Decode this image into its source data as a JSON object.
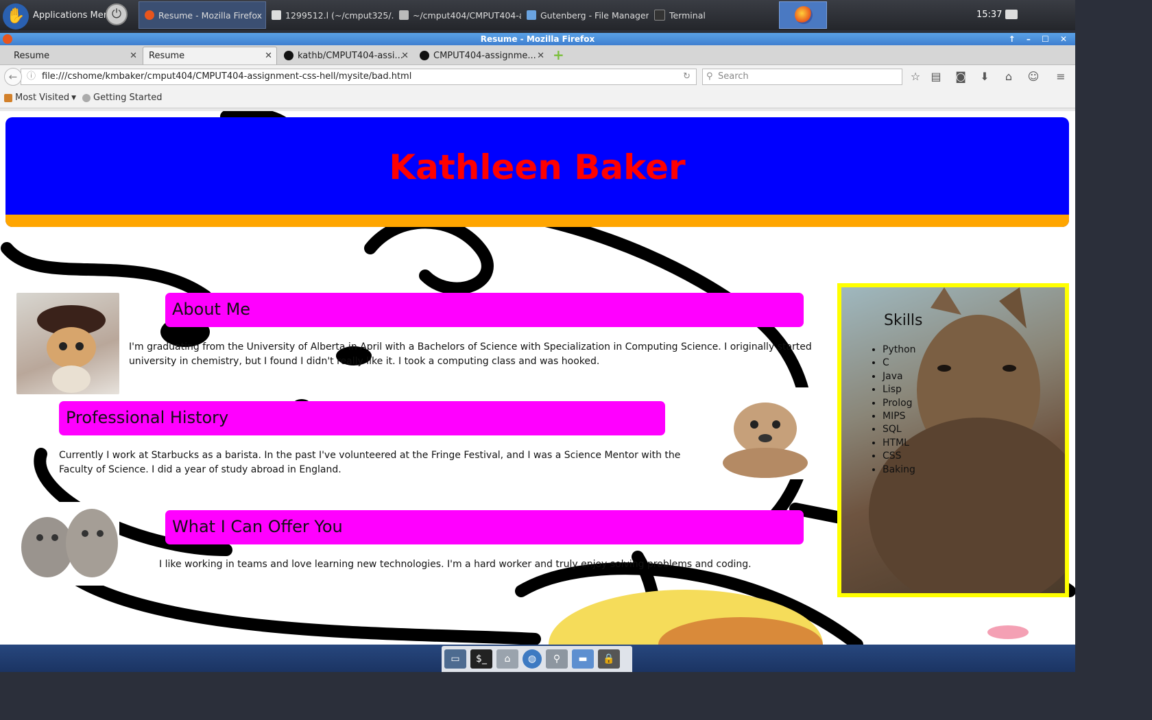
{
  "panel": {
    "apps_menu": "Applications Menu",
    "tasks": [
      {
        "label": "Resume - Mozilla Firefox"
      },
      {
        "label": "1299512.l (~/cmput325/..."
      },
      {
        "label": "~/cmput404/CMPUT404-a..."
      },
      {
        "label": "Gutenberg - File Manager"
      },
      {
        "label": "Terminal"
      }
    ],
    "clock": "15:37"
  },
  "window": {
    "title": "Resume - Mozilla Firefox",
    "tabs": [
      {
        "label": "Resume"
      },
      {
        "label": "Resume"
      },
      {
        "label": "kathb/CMPUT404-assi..."
      },
      {
        "label": "CMPUT404-assignme..."
      }
    ],
    "url": "file:///cshome/kmbaker/cmput404/CMPUT404-assignment-css-hell/mysite/bad.html",
    "search_placeholder": "Search",
    "bookmarks": [
      {
        "label": "Most Visited"
      },
      {
        "label": "Getting Started"
      }
    ]
  },
  "page": {
    "name": "Kathleen Baker",
    "sections": [
      {
        "heading": "About Me",
        "text": "I'm graduating from the University of Alberta in April with a Bachelors of Science with Specialization in Computing Science. I originally started university in chemistry, but I found I didn't really like it. I took a computing class and was hooked."
      },
      {
        "heading": "Professional History",
        "text": "Currently I work at Starbucks as a barista. In the past I've volunteered at the Fringe Festival, and I was a Science Mentor with the Faculty of Science. I did a year of study abroad in England."
      },
      {
        "heading": "What I Can Offer You",
        "text": "I like working in teams and love learning new technologies. I'm a hard worker and truly enjoy solving problems and coding."
      }
    ],
    "skills_title": "Skills",
    "skills": [
      "Python",
      "C",
      "Java",
      "Lisp",
      "Prolog",
      "MIPS",
      "SQL",
      "HTML",
      "CSS",
      "Baking"
    ]
  },
  "colors": {
    "header_bg": "#0000ff",
    "header_text": "#ff0000",
    "header_stripe": "#ffa500",
    "section_heading_bg": "#ff00ff",
    "skills_border": "#ffff00"
  }
}
